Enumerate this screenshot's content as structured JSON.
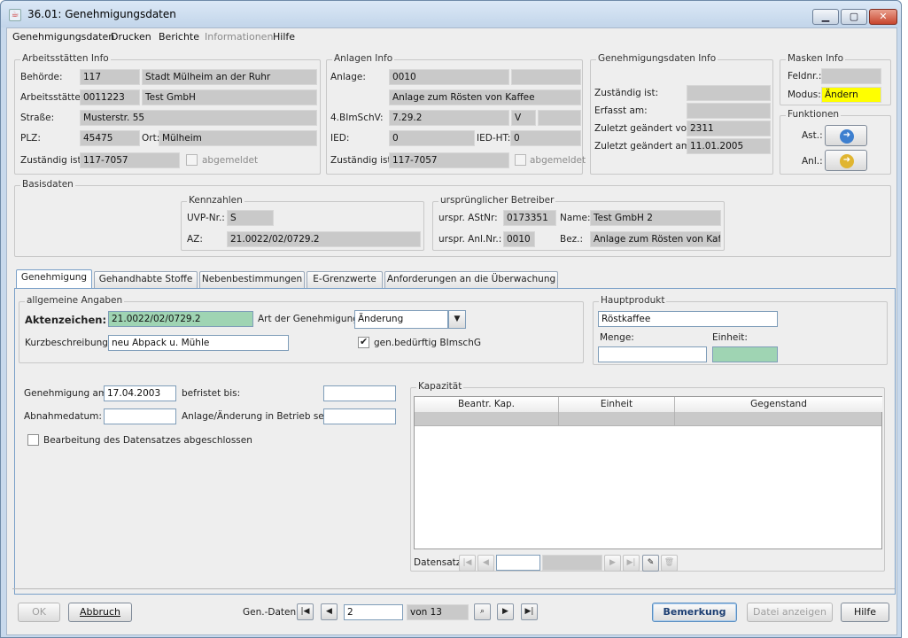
{
  "window": {
    "title": "36.01: Genehmigungsdaten",
    "app_icon": "java-icon"
  },
  "menu": [
    "Genehmigungsdaten",
    "Drucken",
    "Berichte",
    "Informationen",
    "Hilfe"
  ],
  "arbeitsstaetten": {
    "legend": "Arbeitsstätten Info",
    "behoerde_label": "Behörde:",
    "behoerde_nr": "117",
    "behoerde_name": "Stadt Mülheim an der Ruhr",
    "arbeitsstaette_label": "Arbeitsstätte:",
    "arbeitsstaette_nr": "0011223",
    "arbeitsstaette_name": "Test GmbH",
    "strasse_label": "Straße:",
    "strasse": "Musterstr. 55",
    "plz_label": "PLZ:",
    "plz": "45475",
    "ort_label": "Ort:",
    "ort": "Mülheim",
    "zustaendig_label": "Zuständig ist:",
    "zustaendig": "117-7057",
    "abgemeldet": "abgemeldet"
  },
  "anlagen": {
    "legend": "Anlagen Info",
    "anlage_label": "Anlage:",
    "anlage_nr": "0010",
    "anlage_name": "Anlage zum Rösten von Kaffee",
    "bimschv_label": "4.BImSchV:",
    "bimschv": "7.29.2",
    "bimschv_v": "V",
    "ied_label": "IED:",
    "ied": "0",
    "iedht_label": "IED-HT:",
    "iedht": "0",
    "zustaendig_label": "Zuständig ist:",
    "zustaendig": "117-7057",
    "abgemeldet": "abgemeldet"
  },
  "gen_info": {
    "legend": "Genehmigungsdaten Info",
    "zustaendig_label": "Zuständig ist:",
    "erfasst_label": "Erfasst am:",
    "geaendert_von_label": "Zuletzt geändert von:",
    "geaendert_von": "2311",
    "geaendert_am_label": "Zuletzt geändert am:",
    "geaendert_am": "11.01.2005"
  },
  "masken": {
    "legend": "Masken Info",
    "feldnr_label": "Feldnr.:",
    "modus_label": "Modus:",
    "modus": "Ändern"
  },
  "funktionen": {
    "legend": "Funktionen",
    "ast_label": "Ast.:",
    "anl_label": "Anl.:"
  },
  "basisdaten": {
    "legend": "Basisdaten",
    "kennzahlen_legend": "Kennzahlen",
    "uvp_label": "UVP-Nr.:",
    "uvp": "S",
    "az_label": "AZ:",
    "az": "21.0022/02/0729.2",
    "betreiber_legend": "ursprünglicher Betreiber",
    "astnr_label": "urspr. AStNr:",
    "astnr": "0173351",
    "name_label": "Name:",
    "name": "Test GmbH  2",
    "anlnr_label": "urspr. Anl.Nr.:",
    "anlnr": "0010",
    "bez_label": "Bez.:",
    "bez": "Anlage zum Rösten von Kaffee"
  },
  "tabs": [
    "Genehmigung",
    "Gehandhabte Stoffe",
    "Nebenbestimmungen",
    "E-Grenzwerte",
    "Anforderungen an die Überwachung"
  ],
  "allgemein": {
    "legend": "allgemeine Angaben",
    "aktenzeichen_label": "Aktenzeichen:",
    "aktenzeichen": "21.0022/02/0729.2",
    "art_label": "Art der Genehmigung:",
    "art": "Änderung",
    "kurz_label": "Kurzbeschreibung:",
    "kurz": "neu Abpack u. Mühle",
    "bedurftig": "gen.bedürftig BImschG"
  },
  "hauptprodukt": {
    "legend": "Hauptprodukt",
    "produkt": "Röstkaffee",
    "menge_label": "Menge:",
    "einheit_label": "Einheit:"
  },
  "dates": {
    "gen_am_label": "Genehmigung am:",
    "gen_am": "17.04.2003",
    "befristet_label": "befristet bis:",
    "abnahme_label": "Abnahmedatum:",
    "betrieb_label": "Anlage/Änderung in Betrieb seit:",
    "abgeschlossen": "Bearbeitung des Datensatzes abgeschlossen"
  },
  "kapazitaet": {
    "legend": "Kapazität",
    "columns": [
      "Beantr. Kap.",
      "Einheit",
      "Gegenstand"
    ],
    "datensatz_label": "Datensatz:"
  },
  "footer": {
    "ok": "OK",
    "abbruch": "Abbruch",
    "gen_daten_label": "Gen.-Daten",
    "page": "2",
    "von": "von 13",
    "bemerkung": "Bemerkung",
    "datei": "Datei anzeigen",
    "hilfe": "Hilfe"
  }
}
